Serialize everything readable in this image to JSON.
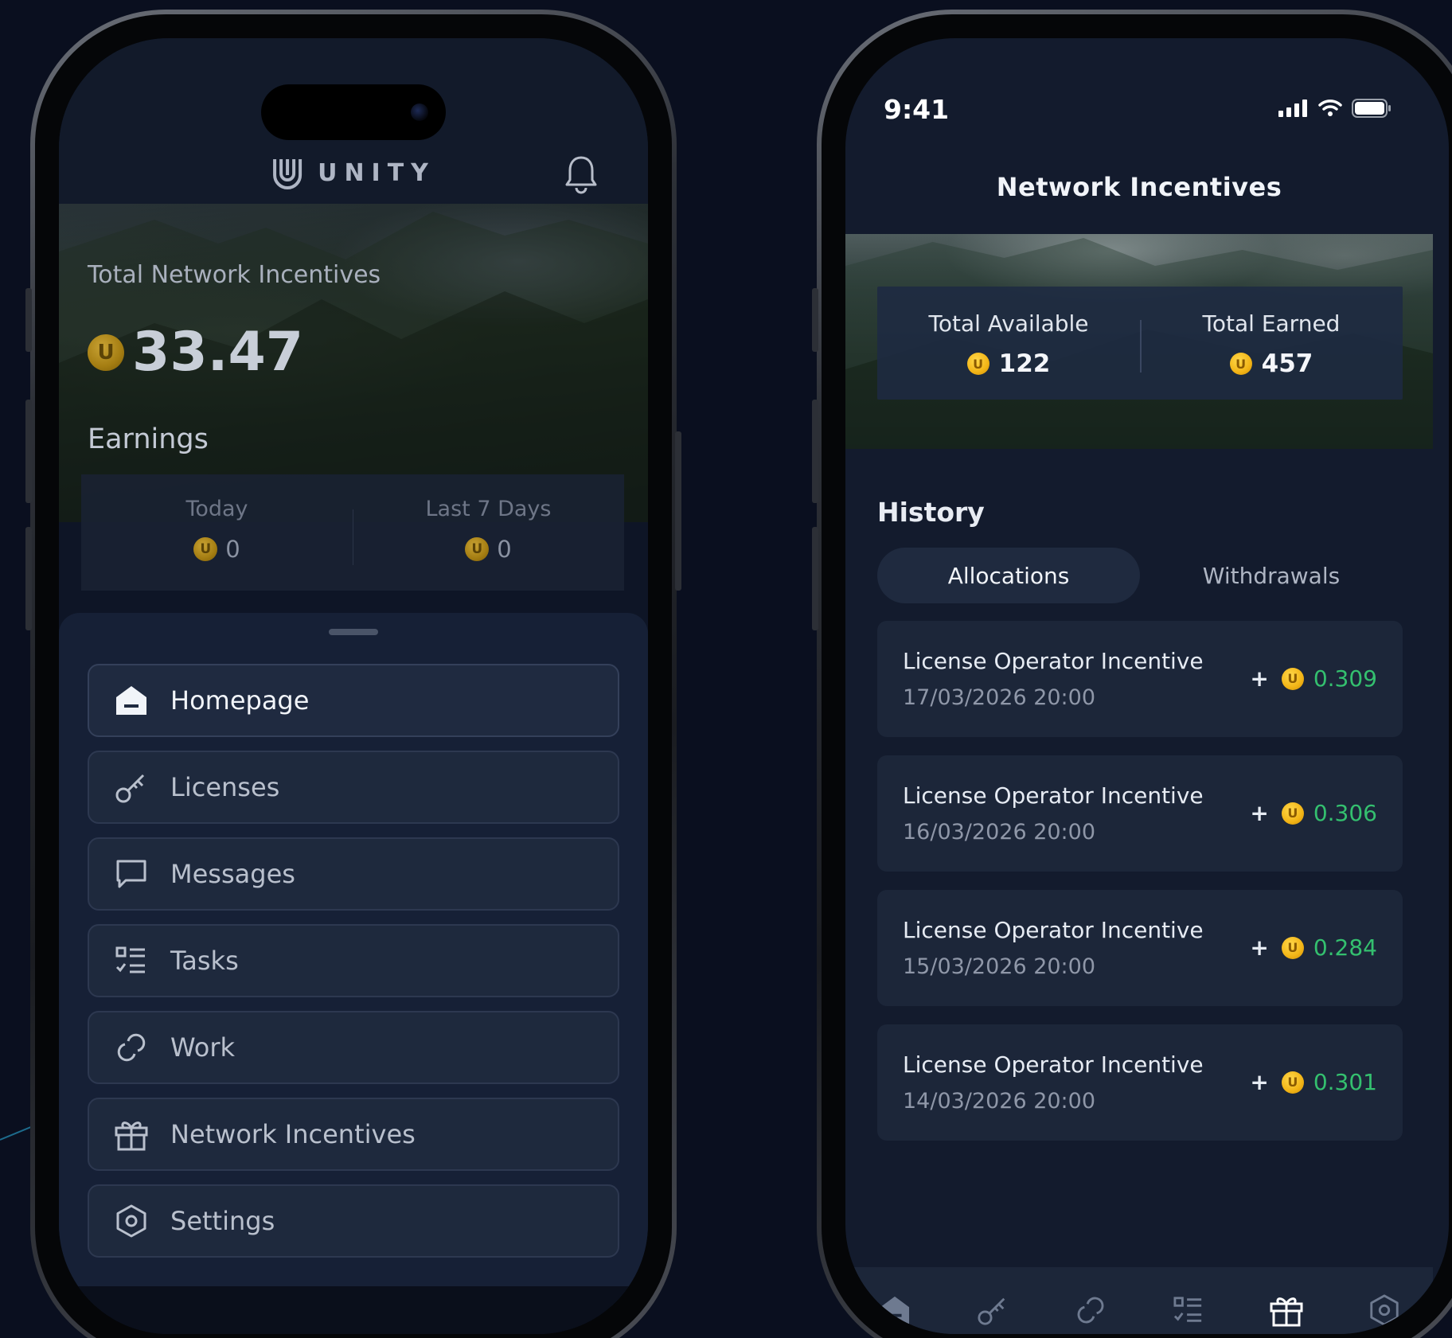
{
  "left_phone": {
    "brand": "UNITY",
    "hero": {
      "label": "Total Network Incentives",
      "amount": "33.47",
      "coin_letter": "U"
    },
    "earnings": {
      "title": "Earnings",
      "today_label": "Today",
      "today_value": "0",
      "week_label": "Last 7 Days",
      "week_value": "0"
    },
    "menu": [
      {
        "label": "Homepage",
        "icon": "home-icon",
        "active": true
      },
      {
        "label": "Licenses",
        "icon": "key-icon"
      },
      {
        "label": "Messages",
        "icon": "message-icon"
      },
      {
        "label": "Tasks",
        "icon": "tasks-icon"
      },
      {
        "label": "Work",
        "icon": "link-icon"
      },
      {
        "label": "Network Incentives",
        "icon": "gift-icon"
      },
      {
        "label": "Settings",
        "icon": "settings-icon"
      }
    ]
  },
  "right_phone": {
    "status_time": "9:41",
    "title": "Network Incentives",
    "totals": {
      "available_label": "Total Available",
      "available_value": "122",
      "earned_label": "Total Earned",
      "earned_value": "457"
    },
    "history_title": "History",
    "tabs": [
      {
        "label": "Allocations",
        "active": true
      },
      {
        "label": "Withdrawals",
        "active": false
      }
    ],
    "transactions": [
      {
        "title": "License Operator Incentive",
        "date": "17/03/2026 20:00",
        "sign": "+",
        "amount": "0.309"
      },
      {
        "title": "License Operator Incentive",
        "date": "16/03/2026 20:00",
        "sign": "+",
        "amount": "0.306"
      },
      {
        "title": "License Operator Incentive",
        "date": "15/03/2026 20:00",
        "sign": "+",
        "amount": "0.284"
      },
      {
        "title": "License Operator Incentive",
        "date": "14/03/2026 20:00",
        "sign": "+",
        "amount": "0.301"
      }
    ],
    "tabbar": [
      "home-icon",
      "key-icon",
      "link-icon",
      "tasks-icon",
      "gift-icon",
      "settings-icon"
    ],
    "active_tab": "gift-icon"
  },
  "colors": {
    "background": "#0a0f1f",
    "accent_cyan": "#1fb6ee",
    "positive_green": "#34c06f",
    "coin_gold": "#f2b416"
  }
}
